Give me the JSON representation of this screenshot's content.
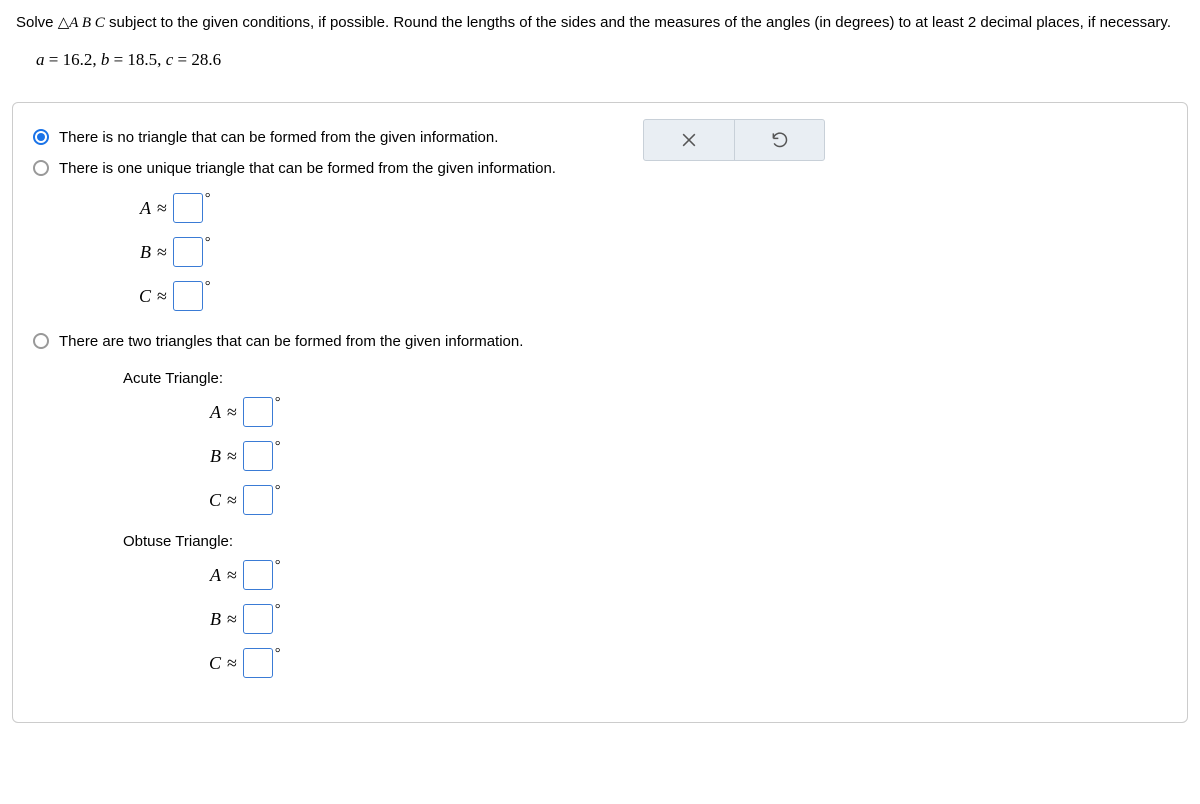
{
  "prompt": {
    "line1": "Solve △ABC subject to the given conditions, if possible. Round the lengths of the sides and the measures of the angles (in degrees) to at least 2 decimal places, if necessary.",
    "given_prefix": "a = 16.2, b = 18.5, c = 28.6"
  },
  "options": {
    "opt1": "There is no triangle that can be formed from the given information.",
    "opt2": "There is one unique triangle that can be formed from the given information.",
    "opt3": "There are two triangles that can be formed from the given information."
  },
  "labels": {
    "A": "A",
    "B": "B",
    "C": "C",
    "approx": "≈",
    "deg": "°",
    "acute": "Acute Triangle:",
    "obtuse": "Obtuse Triangle:"
  },
  "values": {
    "opt2_A": "",
    "opt2_B": "",
    "opt2_C": "",
    "acute_A": "",
    "acute_B": "",
    "acute_C": "",
    "obtuse_A": "",
    "obtuse_B": "",
    "obtuse_C": ""
  }
}
